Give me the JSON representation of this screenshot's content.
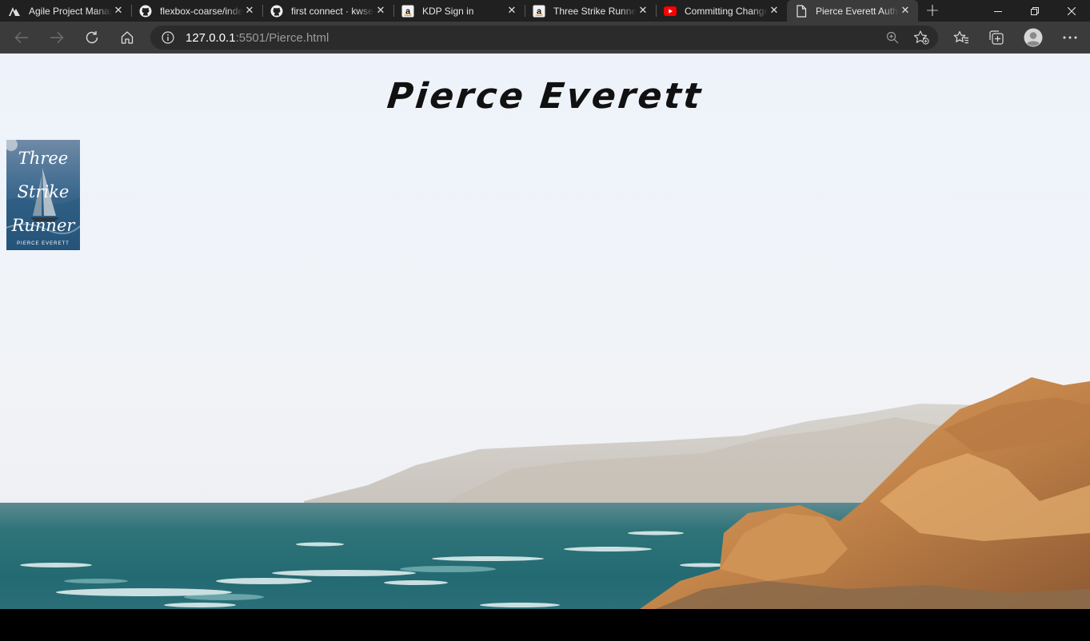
{
  "browser": {
    "tabs": [
      {
        "title": "Agile Project Management",
        "icon": "agile-logo-icon",
        "active": false
      },
      {
        "title": "flexbox-coarse/index",
        "icon": "github-icon",
        "active": false
      },
      {
        "title": "first connect · kwse",
        "icon": "github-icon",
        "active": false
      },
      {
        "title": "KDP Sign in",
        "icon": "amazon-icon",
        "active": false
      },
      {
        "title": "Three Strike Runner",
        "icon": "amazon-icon",
        "active": false
      },
      {
        "title": "Committing Changes",
        "icon": "youtube-icon",
        "active": false
      },
      {
        "title": "Pierce Everett Author",
        "icon": "page-icon",
        "active": true
      }
    ],
    "address": {
      "host": "127.0.0.1",
      "path": ":5501/Pierce.html"
    }
  },
  "page": {
    "heading": "Pierce Everett",
    "book": {
      "title_lines": [
        "Three",
        "Strike",
        "Runner"
      ],
      "author": "PIERCE EVERETT"
    }
  },
  "colors": {
    "tab_bar": "#202020",
    "toolbar": "#3b3b3b",
    "address_bar": "#2b2b2b",
    "sky": "#eef2f8",
    "sea": "#2f7f86",
    "rock": "#c98a4c"
  }
}
